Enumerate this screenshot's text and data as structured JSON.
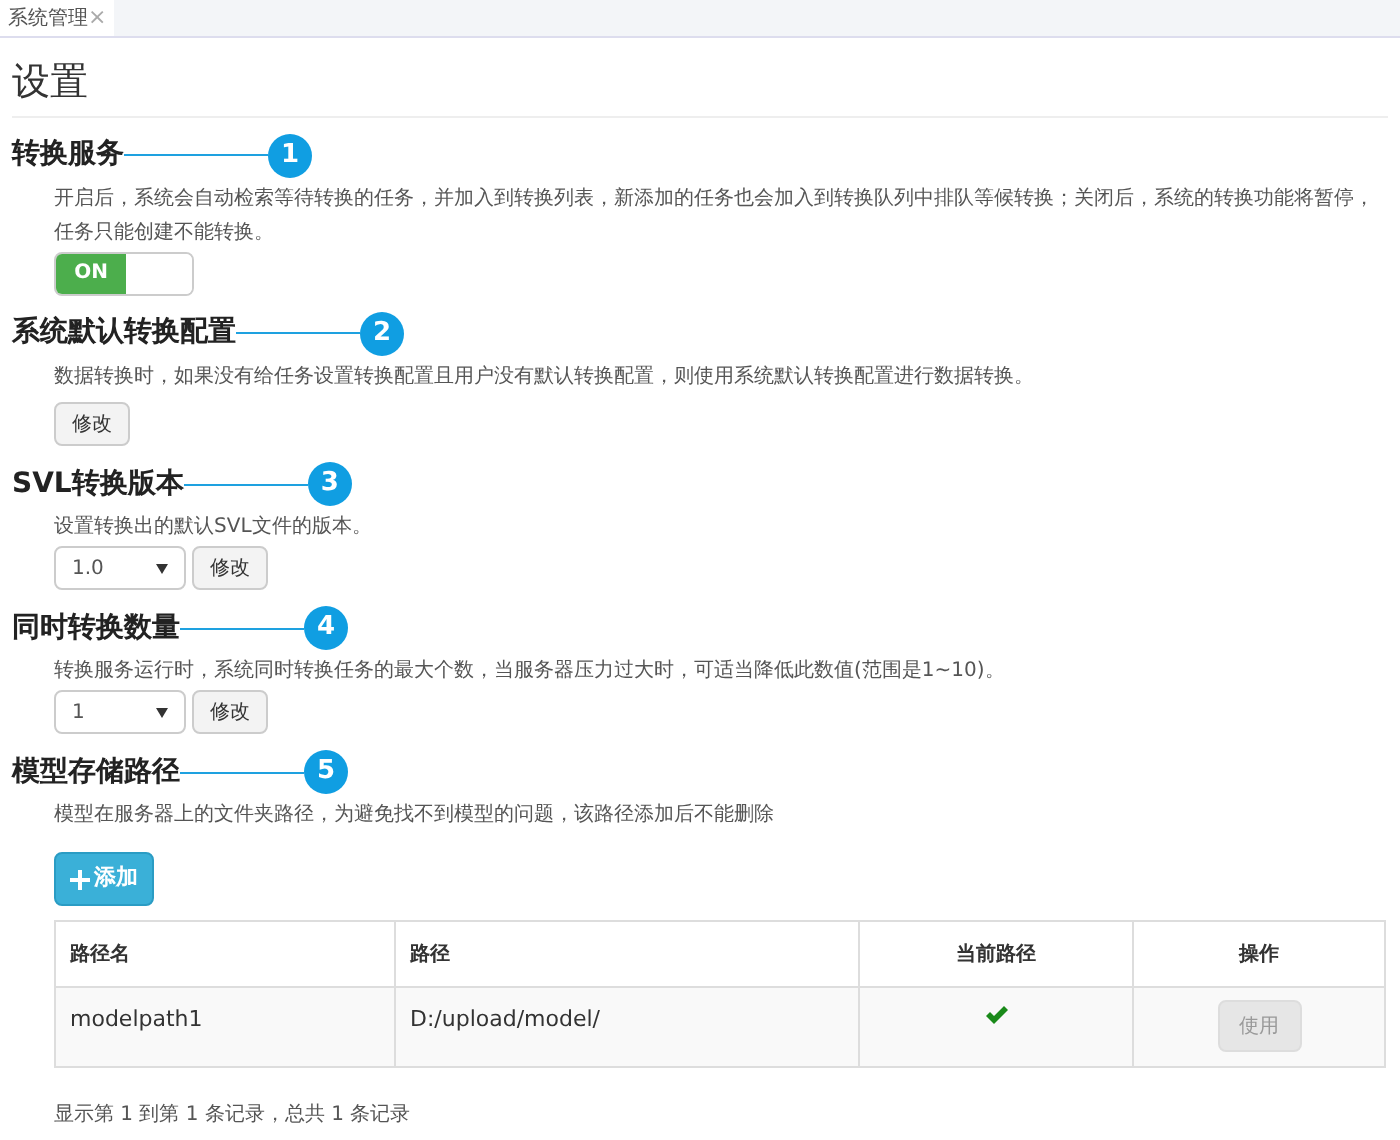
{
  "tab": {
    "label": "系统管理",
    "close": "×",
    "selected": true
  },
  "page_title": "设置",
  "sections": [
    {
      "kind": "toggle",
      "title": "转换服务",
      "callout": "1",
      "description": "开启后，系统会自动检索等待转换的任务，并加入到转换列表，新添加的任务也会加入到转换队列中排队等候转换；关闭后，系统的转换功能将暂停，任务只能创建不能转换。",
      "toggle": {
        "label": "ON",
        "on": true
      }
    },
    {
      "kind": "button",
      "title": "系统默认转换配置",
      "callout": "2",
      "description": "数据转换时，如果没有给任务设置转换配置且用户没有默认转换配置，则使用系统默认转换配置进行数据转换。",
      "button": "修改"
    },
    {
      "kind": "select",
      "title": "SVL转换版本",
      "callout": "3",
      "description": "设置转换出的默认SVL文件的版本。",
      "select": "1.0",
      "button": "修改"
    },
    {
      "kind": "select",
      "title": "同时转换数量",
      "callout": "4",
      "description": "转换服务运行时，系统同时转换任务的最大个数，当服务器压力过大时，可适当降低此数值(范围是1~10)。",
      "select": "1",
      "button": "修改"
    },
    {
      "kind": "table",
      "title": "模型存储路径",
      "callout": "5",
      "description": "模型在服务器上的文件夹路径，为避免找不到模型的问题，该路径添加后不能删除",
      "add_button": "添加",
      "table": {
        "columns": [
          "路径名",
          "路径",
          "当前路径",
          "操作"
        ],
        "rows": [
          {
            "name": "modelpath1",
            "path": "D:/upload/model/",
            "current": true,
            "action": "使用",
            "disabled": true
          }
        ]
      },
      "footer": "显示第 1 到第 1 条记录，总共 1 条记录"
    }
  ]
}
